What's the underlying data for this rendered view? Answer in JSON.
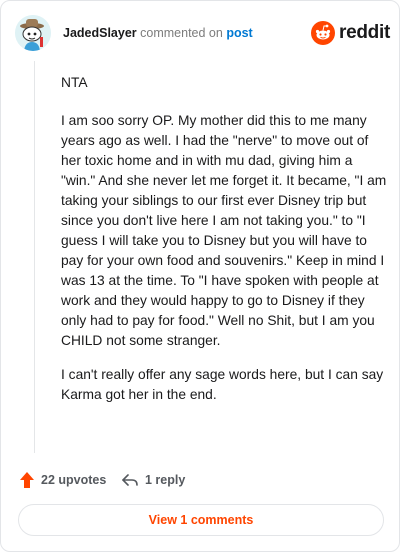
{
  "header": {
    "username": "JadedSlayer",
    "action": "commented on",
    "post_link": "post",
    "brand": "reddit"
  },
  "comment": {
    "paragraphs": [
      "NTA",
      "I am soo sorry OP. My mother did this to me many years ago as well. I had the \"nerve\" to move out of her toxic home and in with mu dad, giving him a \"win.\" And she never let me forget it. It became, \"I am taking your siblings to our first ever Disney trip but since you don't live here I am not taking you.\" to \"I guess I will take you to Disney but you will have to pay for your own food and souvenirs.\" Keep in mind I was 13 at the time. To \"I have spoken with people at work and they would happy to go to Disney if they only had to pay for food.\" Well no Shit, but I am you CHILD not some stranger.",
      "I can't really offer any sage words here, but I can say Karma got her in the end."
    ]
  },
  "footer": {
    "upvotes": "22 upvotes",
    "replies": "1 reply",
    "view_button": "View 1 comments"
  },
  "colors": {
    "brand": "#ff4500",
    "link": "#0079d3",
    "muted": "#7c7c7c"
  },
  "icons": {
    "avatar": "avatar-cowboy-snoo",
    "upvote": "upvote-arrow-icon",
    "reply": "reply-arrow-icon",
    "logo": "reddit-snoo-icon"
  }
}
